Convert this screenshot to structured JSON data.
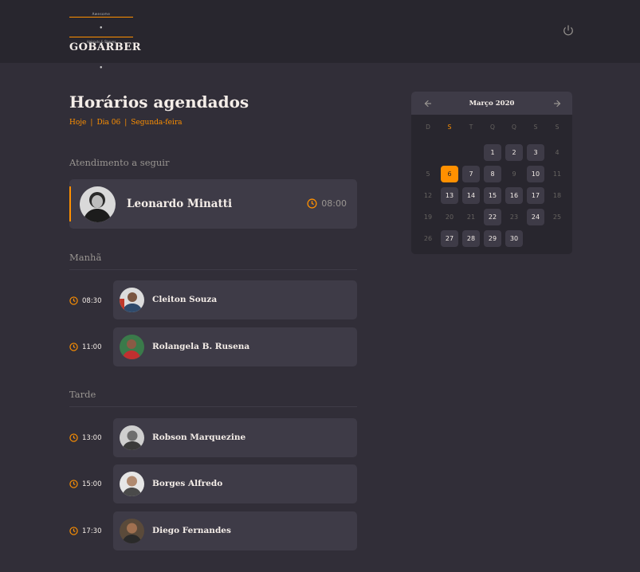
{
  "header": {
    "logo_top": "Awesome",
    "logo_text": "GOBARBER",
    "logo_bottom": "Haircuts & Shaves",
    "power_icon": "power-icon"
  },
  "main": {
    "title": "Horários agendados",
    "subtitle": {
      "today": "Hoje",
      "day": "Dia 06",
      "weekday": "Segunda-feira"
    },
    "next_label": "Atendimento a seguir",
    "next": {
      "name": "Leonardo Minatti",
      "time": "08:00"
    },
    "morning_label": "Manhã",
    "afternoon_label": "Tarde",
    "morning": [
      {
        "time": "08:30",
        "name": "Cleiton Souza"
      },
      {
        "time": "11:00",
        "name": "Rolangela B. Rusena"
      }
    ],
    "afternoon": [
      {
        "time": "13:00",
        "name": "Robson Marquezine"
      },
      {
        "time": "15:00",
        "name": "Borges Alfredo"
      },
      {
        "time": "17:30",
        "name": "Diego Fernandes"
      }
    ]
  },
  "calendar": {
    "month": "Março 2020",
    "weekdays": [
      "D",
      "S",
      "T",
      "Q",
      "Q",
      "S",
      "S"
    ],
    "selected_day": "6",
    "accent_color": "#ff9000"
  }
}
